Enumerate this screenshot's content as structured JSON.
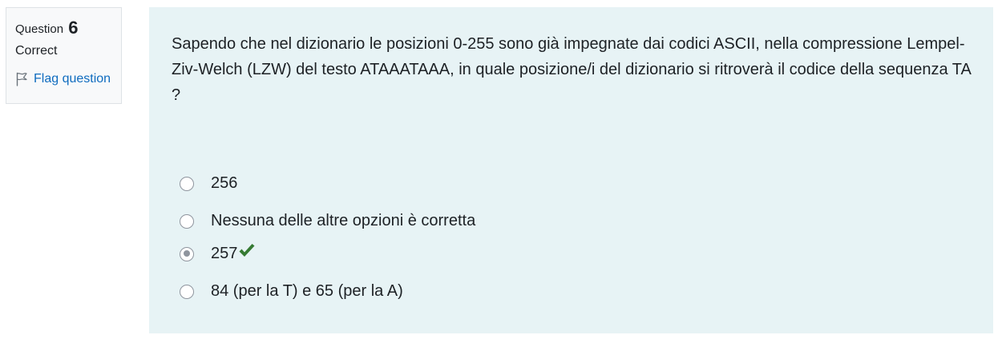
{
  "info": {
    "question_label": "Question",
    "question_number": "6",
    "state": "Correct",
    "flag_label": "Flag question"
  },
  "question": {
    "text": "Sapendo che nel dizionario le posizioni 0-255 sono già impegnate dai codici ASCII, nella compressione Lempel-Ziv-Welch (LZW) del testo ATAAATAAA, in quale posizione/i del dizionario si ritroverà il codice della sequenza TA ?"
  },
  "answers": [
    {
      "label": "256",
      "selected": false,
      "correct": false
    },
    {
      "label": "Nessuna delle altre opzioni è corretta",
      "selected": false,
      "correct": false
    },
    {
      "label": "257",
      "selected": true,
      "correct": true
    },
    {
      "label": "84 (per la T) e 65 (per la A)",
      "selected": false,
      "correct": false
    }
  ],
  "colors": {
    "info_bg": "#f8f9fa",
    "content_bg": "#e7f3f5",
    "link": "#0f6cbf",
    "correct_check": "#357a32"
  },
  "icons": {
    "flag": "flag-outline-icon",
    "correct": "checkmark-icon"
  }
}
